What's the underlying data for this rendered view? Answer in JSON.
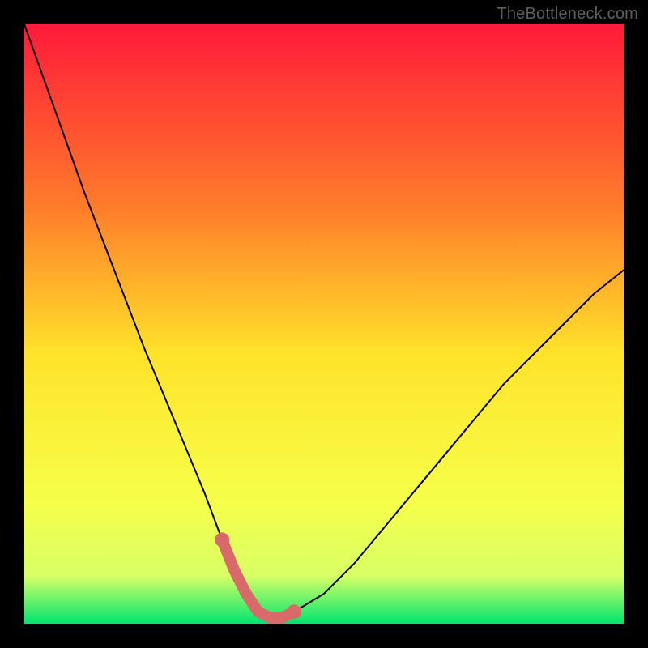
{
  "watermark": "TheBottleneck.com",
  "colors": {
    "frame": "#000000",
    "gradient_top": "#ff1a3a",
    "gradient_mid_upper": "#ff7a2a",
    "gradient_mid": "#ffe32a",
    "gradient_lower": "#f6ff4a",
    "gradient_band": "#d8ff66",
    "gradient_bottom": "#00e56f",
    "curve": "#000000",
    "highlight": "#d96a6a"
  },
  "chart_data": {
    "type": "line",
    "title": "",
    "xlabel": "",
    "ylabel": "",
    "xlim": [
      0,
      100
    ],
    "ylim": [
      0,
      100
    ],
    "series": [
      {
        "name": "bottleneck-curve",
        "x": [
          0,
          5,
          10,
          15,
          20,
          25,
          30,
          33,
          35,
          37,
          39,
          41,
          43,
          45,
          50,
          55,
          60,
          65,
          70,
          75,
          80,
          85,
          90,
          95,
          100
        ],
        "y": [
          100,
          86,
          72,
          59,
          46,
          34,
          22,
          14,
          9,
          5,
          2,
          1,
          1,
          2,
          5,
          10,
          16,
          22,
          28,
          34,
          40,
          45,
          50,
          55,
          59
        ]
      }
    ],
    "highlight_region": {
      "name": "optimal-range",
      "x": [
        33,
        35,
        37,
        39,
        41,
        43,
        45
      ],
      "y": [
        14,
        9,
        5,
        2,
        1,
        1,
        2
      ]
    }
  }
}
